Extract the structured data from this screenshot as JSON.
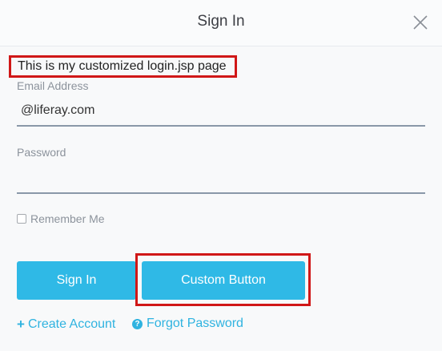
{
  "header": {
    "title": "Sign In",
    "close_icon": "close-icon"
  },
  "custom_message": "This is my customized login.jsp page",
  "form": {
    "email": {
      "label": "Email Address",
      "value": "@liferay.com"
    },
    "password": {
      "label": "Password",
      "value": ""
    },
    "remember_me": {
      "label": "Remember Me",
      "checked": false
    }
  },
  "buttons": {
    "sign_in": "Sign In",
    "custom": "Custom Button"
  },
  "links": {
    "create_account": {
      "icon": "plus-icon",
      "label": "Create Account"
    },
    "forgot_password": {
      "icon": "question-circle-icon",
      "label": "Forgot Password"
    }
  },
  "colors": {
    "accent": "#2fb9e6",
    "highlight": "#d01717"
  }
}
